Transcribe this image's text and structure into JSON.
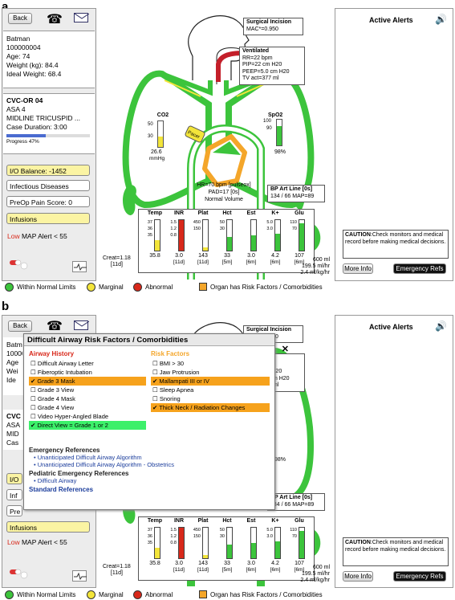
{
  "panels": {
    "a": "a",
    "b": "b"
  },
  "nav": {
    "back": "Back",
    "phone_icon": "phone-icon",
    "mail_icon": "mail-icon"
  },
  "patient": {
    "name": "Batman",
    "id": "100000004",
    "age": "Age: 74",
    "weight": "Weight (kg): 84.4",
    "ideal": "Ideal Weight: 68.4"
  },
  "case": {
    "room": "CVC-OR 04",
    "asa": "ASA 4",
    "procedure": "MIDLINE TRICUSPID ...",
    "duration": "Case Duration: 3:00",
    "progress_label": "Progress 47%",
    "progress": 0.47
  },
  "buttons": {
    "io": "I/O Balance: -1452",
    "infectious": "Infectious Diseases",
    "pain": "PreOp Pain Score: 0",
    "infusions": "Infusions"
  },
  "map_alert": {
    "low": "Low",
    "text": " MAP Alert < 55"
  },
  "incision": {
    "title": "Surgical Incision",
    "mac": "MAC*=0.950"
  },
  "vent": {
    "title": "Ventilated",
    "rr": "RR=22 bpm",
    "pip": "PIP=22 cm H20",
    "peep": "PEEP=5.0 cm H20",
    "tv": "TV act=377 ml"
  },
  "co2": {
    "title": "CO2",
    "ticks": [
      "50",
      "30"
    ],
    "value": "26.6",
    "unit": "mmHg",
    "level": 0.4
  },
  "spo2": {
    "title": "SpO2",
    "ticks": [
      "100",
      "90"
    ],
    "value": "98%",
    "level": 0.75
  },
  "pacer": "Pacer",
  "hr": {
    "line1": "HR=70 bpm [pulseox]",
    "line2": "PAD=17 [0s]",
    "line3": "Normal Volume"
  },
  "bp": {
    "title": "BP Art Line [0s]",
    "value": "134 / 66 MAP=89"
  },
  "labs": [
    {
      "name": "Temp",
      "ticks": [
        "37",
        "36",
        "35"
      ],
      "value": "35.8",
      "sub": "",
      "color": "#f3e53a",
      "level": 0.35
    },
    {
      "name": "INR",
      "ticks": [
        "1.5",
        "1.2",
        "0.8"
      ],
      "value": "3.0",
      "sub": "[11d]",
      "color": "#d8281a",
      "level": 1.0
    },
    {
      "name": "Plat",
      "ticks": [
        "450",
        "150"
      ],
      "value": "143",
      "sub": "[11d]",
      "color": "#f3e53a",
      "level": 0.1
    },
    {
      "name": "Hct",
      "ticks": [
        "50",
        "30"
      ],
      "value": "33",
      "sub": "[5m]",
      "color": "#3cc43c",
      "level": 0.45
    },
    {
      "name": "Est",
      "ticks": [],
      "value": "3.0",
      "sub": "[6m]",
      "color": "#3cc43c",
      "level": 0.5
    },
    {
      "name": "K+",
      "ticks": [
        "5.0",
        "3.0"
      ],
      "value": "4.2",
      "sub": "[6m]",
      "color": "#3cc43c",
      "level": 0.55
    },
    {
      "name": "Glu",
      "ticks": [
        "110",
        "70"
      ],
      "value": "107",
      "sub": "[6m]",
      "color": "#3cc43c",
      "level": 0.9
    }
  ],
  "creat": {
    "line1": "Creat=1.18",
    "line2": "[11d]"
  },
  "urine": {
    "line1": "600 ml",
    "line2": "199.5 ml/hr",
    "line3": "2.4 ml/kg/hr"
  },
  "alerts": {
    "title": "Active Alerts",
    "caution_bold": "CAUTION",
    "caution_text": ":Check monitors and medical record before making medical decisions.",
    "more_info": "More Info",
    "emergency": "Emergency Refs"
  },
  "legend": {
    "normal": "Within Normal Limits",
    "marginal": "Marginal",
    "abnormal": "Abnormal",
    "risk": "Organ has Risk Factors / Comorbidities"
  },
  "colors": {
    "green": "#3cc43c",
    "yellow": "#f3e53a",
    "red": "#d8281a",
    "orange": "#f4a62a",
    "blue_bar": "#4a6bd0"
  },
  "modal": {
    "title": "Difficult Airway Risk Factors / Comorbidities",
    "close": "✕",
    "airway_header": "Airway History",
    "airway": [
      {
        "label": "Difficult Airway Letter",
        "checked": false,
        "hl": ""
      },
      {
        "label": "Fiberoptic Intubation",
        "checked": false,
        "hl": ""
      },
      {
        "label": "Grade 3 Mask",
        "checked": true,
        "hl": "orange"
      },
      {
        "label": "Grade 3 View",
        "checked": false,
        "hl": ""
      },
      {
        "label": "Grade 4 Mask",
        "checked": false,
        "hl": ""
      },
      {
        "label": "Grade 4 View",
        "checked": false,
        "hl": ""
      },
      {
        "label": "Video Hyper-Angled Blade",
        "checked": false,
        "hl": ""
      },
      {
        "label": "Direct View = Grade 1 or 2",
        "checked": true,
        "hl": "green"
      }
    ],
    "risk_header": "Risk Factors",
    "risk": [
      {
        "label": "BMI > 30",
        "checked": false,
        "hl": ""
      },
      {
        "label": "Jaw Protrusion",
        "checked": false,
        "hl": ""
      },
      {
        "label": "Mallampati III or IV",
        "checked": true,
        "hl": "orange"
      },
      {
        "label": "Sleep Apnea",
        "checked": false,
        "hl": ""
      },
      {
        "label": "Snoring",
        "checked": false,
        "hl": ""
      },
      {
        "label": "Thick Neck / Radiation Changes",
        "checked": true,
        "hl": "orange"
      }
    ],
    "emerg_header": "Emergency References",
    "emerg": [
      "Unanticipated Difficult Airway Algorithm",
      "Unanticipated Difficult Airway Algorithm - Obstetrics"
    ],
    "ped_header": "Pediatric Emergency References",
    "ped": [
      "Difficult Airway"
    ],
    "std_header": "Standard References"
  },
  "panel_b_visible": {
    "age_frag": "Age",
    "weight_frag": "Wei",
    "ideal_frag": "Ide",
    "cvc_frag": "CVC",
    "asa_frag": "ASA",
    "mid_frag": "MID",
    "case_frag": "Cas",
    "io_frag": "I/O",
    "inf_frag": "Inf",
    "pre_frag": "Pre"
  }
}
